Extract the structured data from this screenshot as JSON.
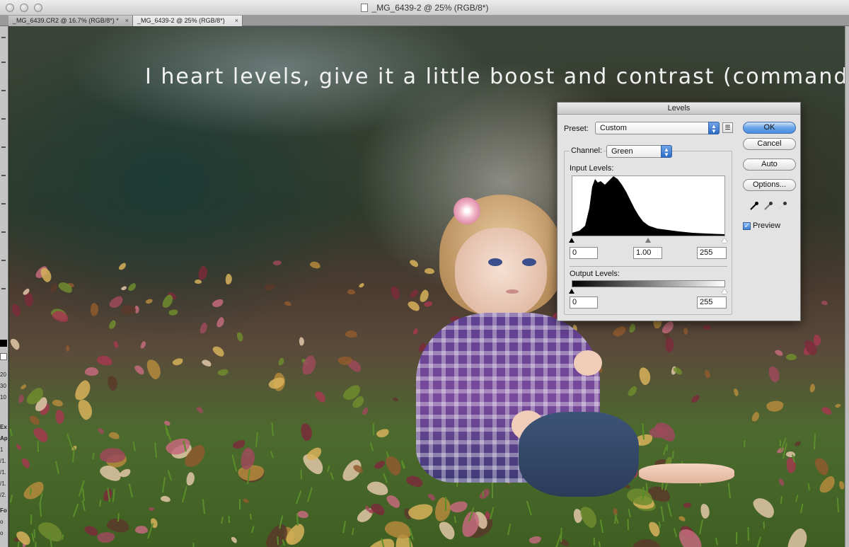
{
  "window": {
    "title": "_MG_6439-2 @ 25% (RGB/8*)"
  },
  "tabs": [
    {
      "label": "_MG_6439.CR2 @ 16.7% (RGB/8*) *",
      "close": "×",
      "active": false
    },
    {
      "label": "_MG_6439-2 @ 25% (RGB/8*)",
      "close": "×",
      "active": true
    }
  ],
  "left_panel": {
    "fragments": [
      "20",
      "30",
      "10",
      "Ex",
      "Ap",
      "1",
      "/1.",
      "/1.",
      "/1.",
      "/2.",
      "Fo",
      "o",
      "o"
    ]
  },
  "caption": "I heart levels, give it a little boost and contrast (command+L)",
  "levels_dialog": {
    "title": "Levels",
    "preset_label": "Preset:",
    "preset_value": "Custom",
    "channel_label": "Channel:",
    "channel_value": "Green",
    "input_levels_label": "Input Levels:",
    "input_black": "0",
    "input_gamma": "1.00",
    "input_white": "255",
    "output_levels_label": "Output Levels:",
    "output_black": "0",
    "output_white": "255",
    "buttons": {
      "ok": "OK",
      "cancel": "Cancel",
      "auto": "Auto",
      "options": "Options..."
    },
    "preview_label": "Preview",
    "preview_checked": true,
    "accent_color": "#3b7fd8"
  }
}
